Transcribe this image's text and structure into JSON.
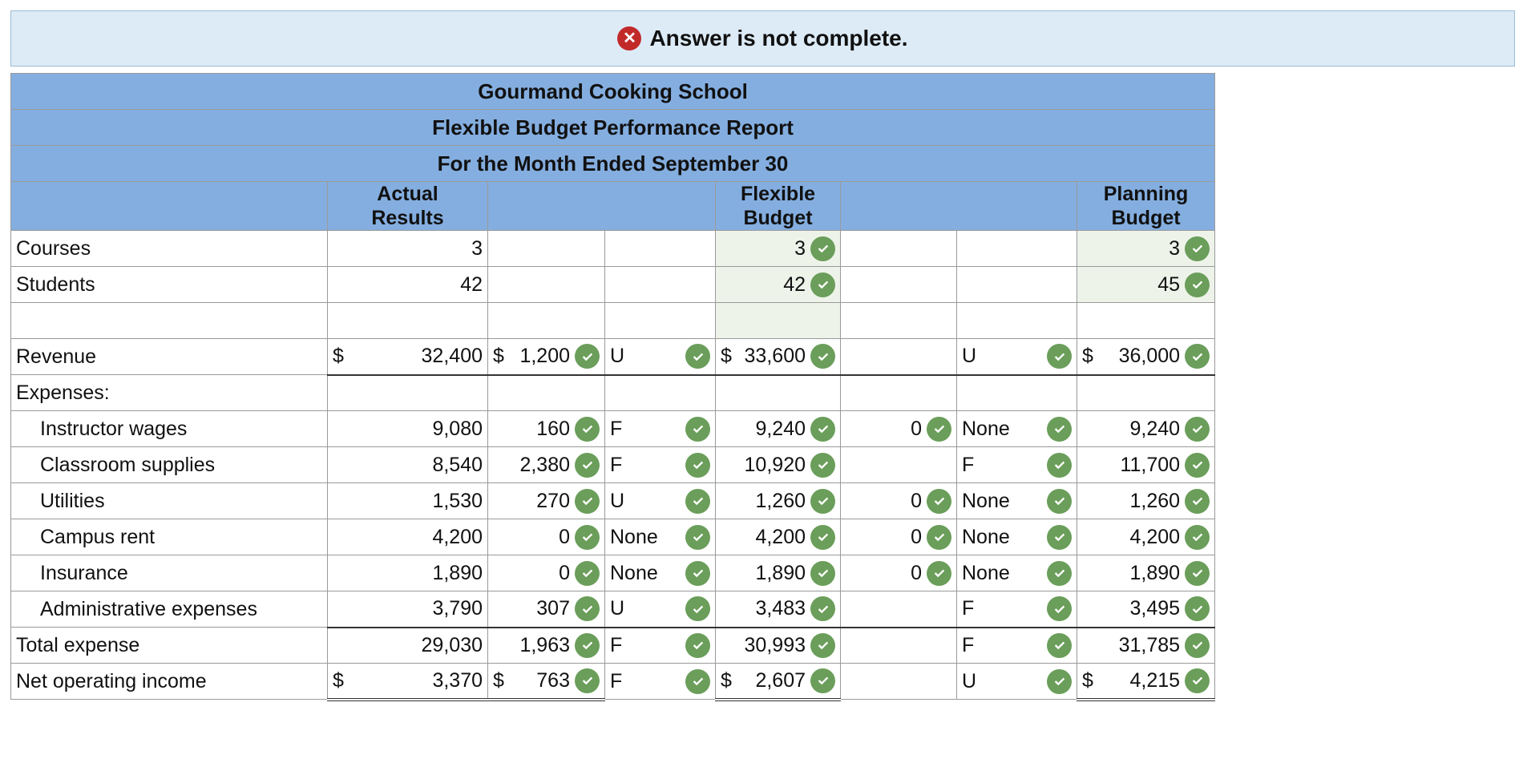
{
  "banner": {
    "status_icon": "x-circle-icon",
    "message": "Answer is not complete.",
    "color": "#c22a2a"
  },
  "report": {
    "company": "Gourmand Cooking School",
    "title": "Flexible Budget Performance Report",
    "period": "For the Month Ended September 30",
    "col_actual_1": "Actual",
    "col_actual_2": "Results",
    "col_flex_1": "Flexible",
    "col_flex_2": "Budget",
    "col_plan_1": "Planning",
    "col_plan_2": "Budget"
  },
  "rows": {
    "courses": {
      "label": "Courses",
      "actual": "3",
      "flexible": "3",
      "planning": "3"
    },
    "students": {
      "label": "Students",
      "actual": "42",
      "flexible": "42",
      "planning": "45"
    },
    "revenue": {
      "label": "Revenue",
      "dollar": "$",
      "actual": "32,400",
      "rev_var": "1,200",
      "rev_fu": "U",
      "flexible": "33,600",
      "act_var": "",
      "act_fu": "U",
      "planning": "36,000"
    },
    "expenses_label": "Expenses:",
    "instructor": {
      "label": "Instructor wages",
      "actual": "9,080",
      "rev_var": "160",
      "rev_fu": "F",
      "flexible": "9,240",
      "act_var": "0",
      "act_fu": "None",
      "planning": "9,240"
    },
    "supplies": {
      "label": "Classroom supplies",
      "actual": "8,540",
      "rev_var": "2,380",
      "rev_fu": "F",
      "flexible": "10,920",
      "act_var": "",
      "act_fu": "F",
      "planning": "11,700"
    },
    "utilities": {
      "label": "Utilities",
      "actual": "1,530",
      "rev_var": "270",
      "rev_fu": "U",
      "flexible": "1,260",
      "act_var": "0",
      "act_fu": "None",
      "planning": "1,260"
    },
    "rent": {
      "label": "Campus rent",
      "actual": "4,200",
      "rev_var": "0",
      "rev_fu": "None",
      "flexible": "4,200",
      "act_var": "0",
      "act_fu": "None",
      "planning": "4,200"
    },
    "insurance": {
      "label": "Insurance",
      "actual": "1,890",
      "rev_var": "0",
      "rev_fu": "None",
      "flexible": "1,890",
      "act_var": "0",
      "act_fu": "None",
      "planning": "1,890"
    },
    "admin": {
      "label": "Administrative expenses",
      "actual": "3,790",
      "rev_var": "307",
      "rev_fu": "U",
      "flexible": "3,483",
      "act_var": "",
      "act_fu": "F",
      "planning": "3,495"
    },
    "total": {
      "label": "Total expense",
      "actual": "29,030",
      "rev_var": "1,963",
      "rev_fu": "F",
      "flexible": "30,993",
      "act_var": "",
      "act_fu": "F",
      "planning": "31,785"
    },
    "noi": {
      "label": "Net operating income",
      "dollar": "$",
      "actual": "3,370",
      "rev_var": "763",
      "rev_fu": "F",
      "flexible": "2,607",
      "act_var": "",
      "act_fu": "U",
      "planning": "4,215"
    }
  },
  "colors": {
    "header": "#84aee0",
    "check": "#6a9e5a",
    "banner_bg": "#ddebf7"
  }
}
